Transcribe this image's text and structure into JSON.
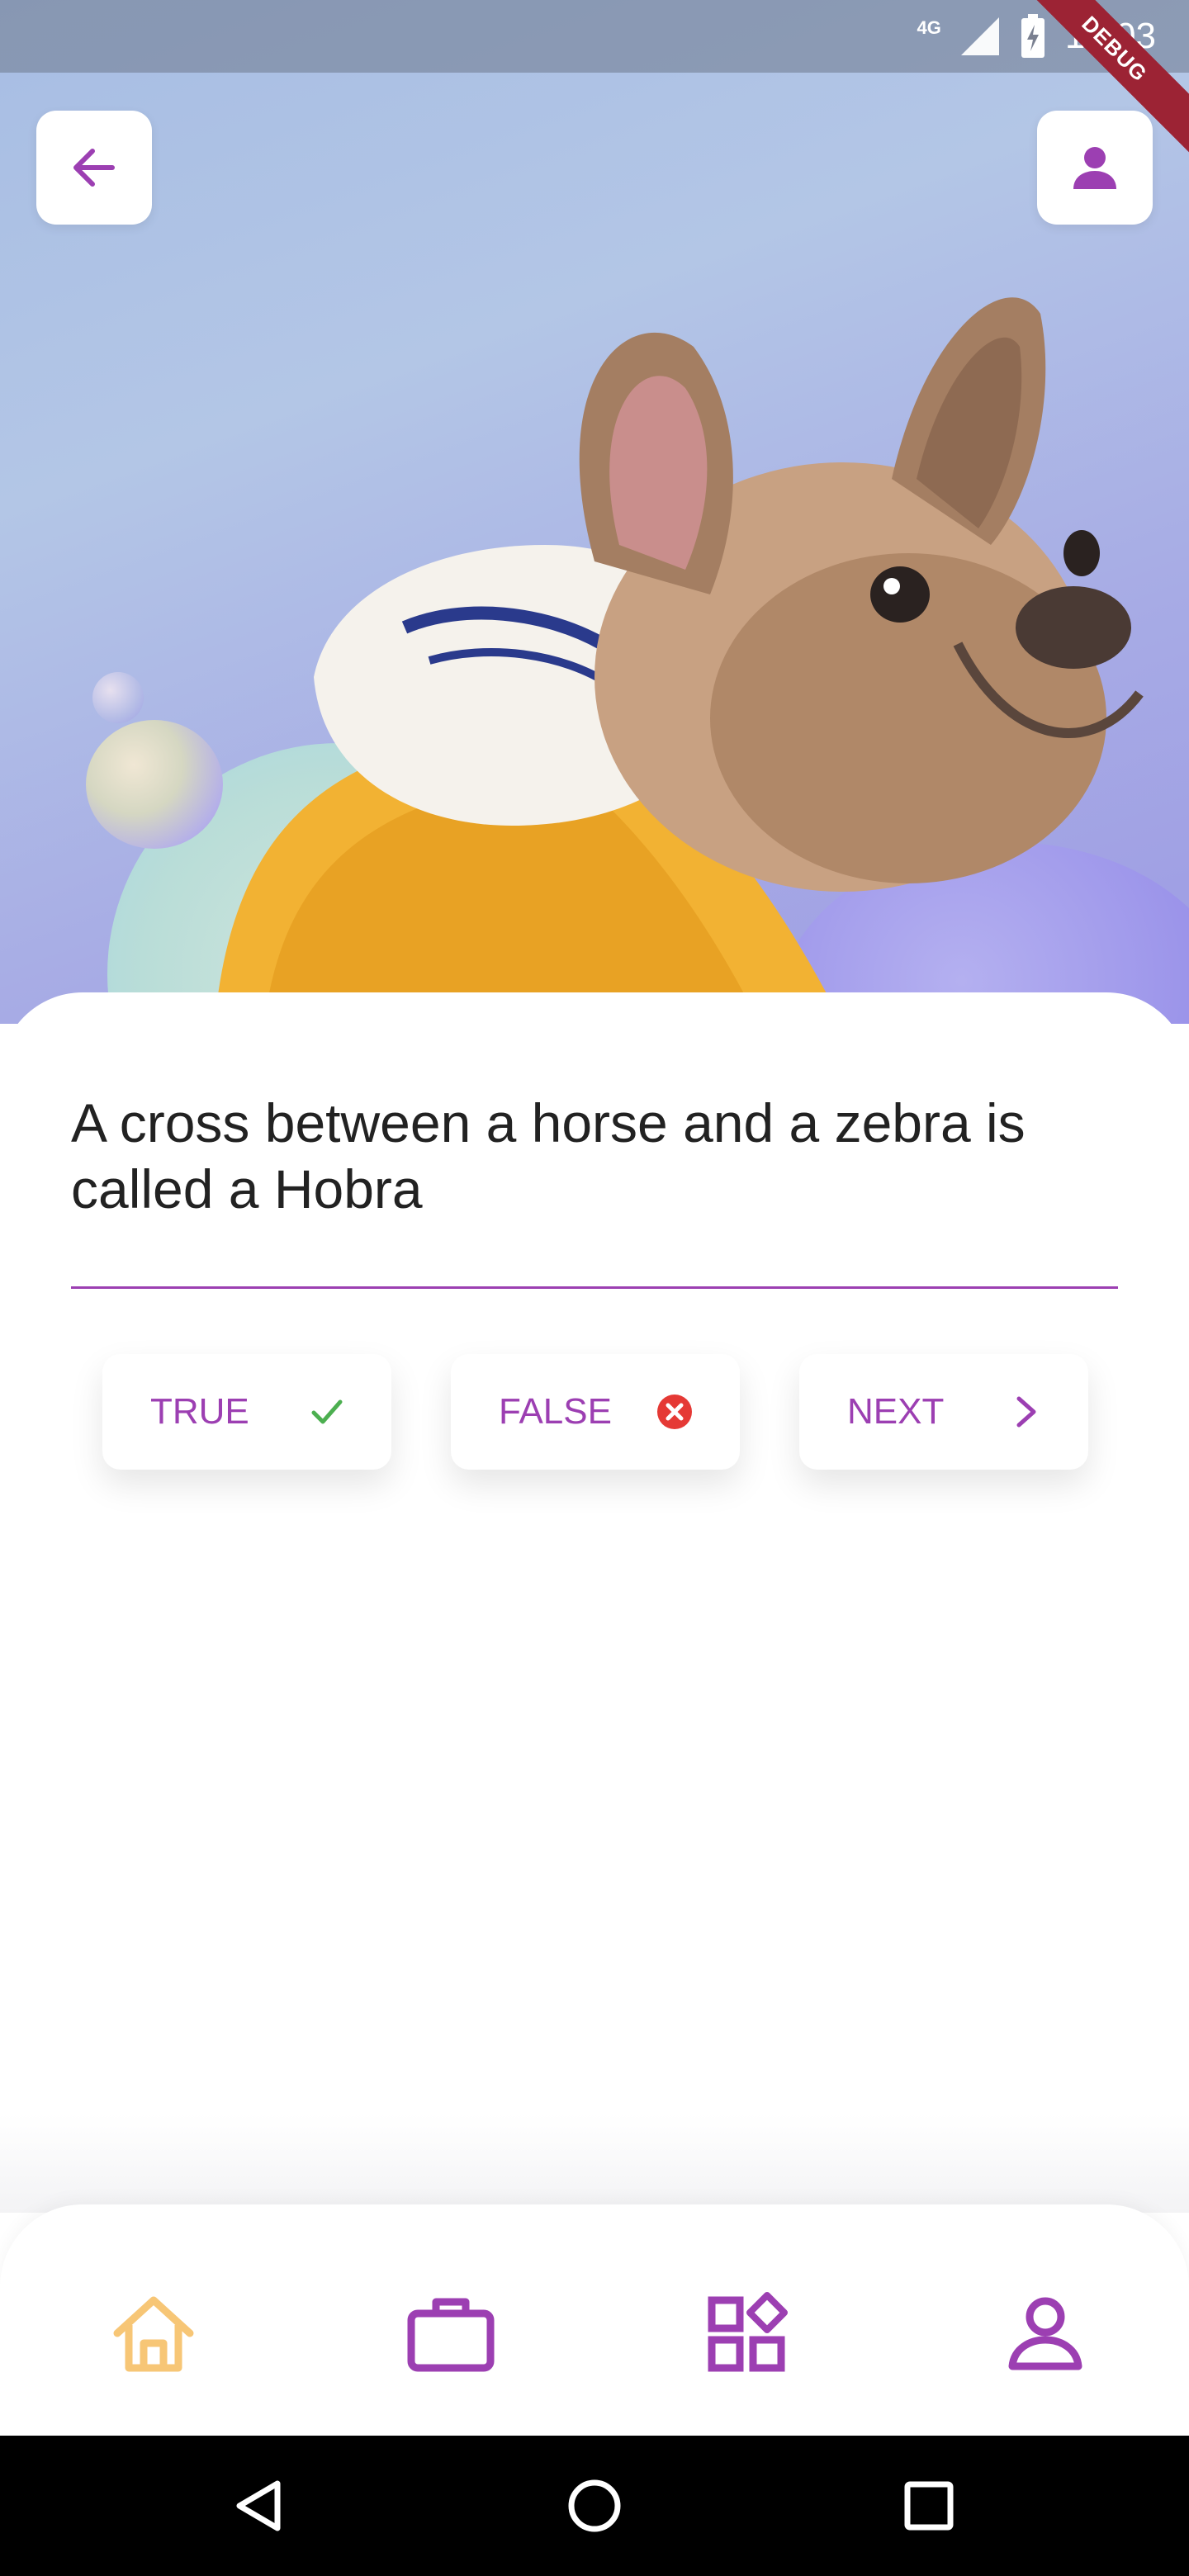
{
  "status_bar": {
    "network": "4G",
    "time": "12:03",
    "debug_label": "DEBUG"
  },
  "header": {
    "back_icon": "arrow-left-icon",
    "profile_icon": "person-icon"
  },
  "quiz": {
    "question": "A cross between a horse and a zebra is called a Hobra",
    "answers": [
      {
        "label": "TRUE",
        "icon": "check-icon",
        "icon_color": "#4caf50"
      },
      {
        "label": "FALSE",
        "icon": "cancel-icon",
        "icon_color": "#e53935"
      },
      {
        "label": "NEXT",
        "icon": "chevron-right-icon",
        "icon_color": "#9c3fb2"
      }
    ]
  },
  "bottom_nav": {
    "items": [
      {
        "name": "home",
        "icon": "home-icon",
        "active": true,
        "color": "#f7c676"
      },
      {
        "name": "work",
        "icon": "briefcase-icon",
        "active": false,
        "color": "#9c3fb2"
      },
      {
        "name": "categories",
        "icon": "category-icon",
        "active": false,
        "color": "#9c3fb2"
      },
      {
        "name": "profile",
        "icon": "person-outline-icon",
        "active": false,
        "color": "#9c3fb2"
      }
    ]
  },
  "colors": {
    "accent": "#9c3fb2",
    "active_nav": "#f7c676",
    "hero_bg": "#b3c6e6"
  }
}
